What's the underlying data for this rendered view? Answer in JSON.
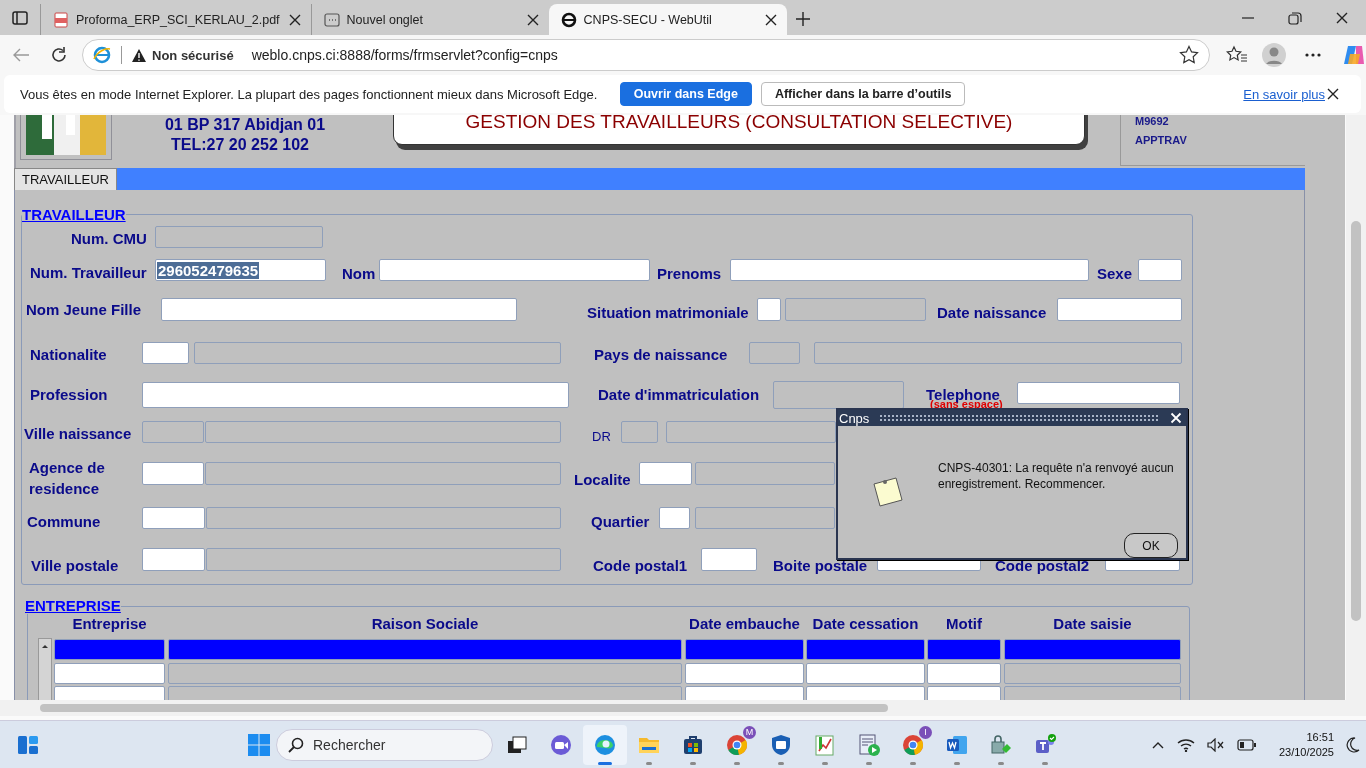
{
  "browser": {
    "tabs": [
      {
        "kind": "pdf",
        "title": "Proforma_ERP_SCI_KERLAU_2.pdf",
        "selected": false
      },
      {
        "kind": "newtab",
        "title": "Nouvel onglet",
        "selected": false
      },
      {
        "kind": "ie",
        "title": "CNPS-SECU - WebUtil",
        "selected": true
      }
    ],
    "address_bar": {
      "security": "Non sécurisé",
      "url": "weblo.cnps.ci:8888/forms/frmservlet?config=cnps"
    },
    "ie_mode_bar": {
      "message": "Vous êtes en mode Internet Explorer. La plupart des pages fonctionnent mieux dans Microsoft Edge.",
      "buttons": [
        {
          "label": "Ouvrir dans Edge",
          "primary": true
        },
        {
          "label": "Afficher dans la barre d’outils",
          "primary": false
        }
      ],
      "link": "En savoir plus"
    }
  },
  "header": {
    "address": "01 BP 317 Abidjan 01",
    "phone": "TEL:27 20 252 102",
    "title": "GESTION DES TRAVAILLEURS (CONSULTATION SELECTIVE)",
    "codes": [
      "M9692",
      "APPTRAV"
    ]
  },
  "form_tabs": [
    {
      "label": "TRAVAILLEUR",
      "selected": true
    }
  ],
  "travailleur": {
    "title": "TRAVAILLEUR",
    "fields": [
      {
        "label": "Num. CMU",
        "boxes": [
          {
            "editable": false
          }
        ]
      },
      {
        "label": "Num. Travailleur",
        "boxes": [
          {
            "editable": true,
            "value": "296052479635",
            "highlighted": true
          }
        ]
      },
      {
        "label": "Nom",
        "boxes": [
          {
            "editable": true
          }
        ]
      },
      {
        "label": "Prenoms",
        "boxes": [
          {
            "editable": true
          }
        ]
      },
      {
        "label": "Sexe",
        "boxes": [
          {
            "editable": true
          }
        ]
      },
      {
        "label": "Nom Jeune Fille",
        "boxes": [
          {
            "editable": true
          }
        ]
      },
      {
        "label": "Situation matrimoniale",
        "boxes": [
          {
            "editable": true
          },
          {
            "editable": false
          }
        ]
      },
      {
        "label": "Date naissance",
        "boxes": [
          {
            "editable": true
          }
        ]
      },
      {
        "label": "Nationalite",
        "boxes": [
          {
            "editable": true
          },
          {
            "editable": false
          }
        ]
      },
      {
        "label": "Pays de naissance",
        "boxes": [
          {
            "editable": false
          },
          {
            "editable": false
          }
        ]
      },
      {
        "label": "Profession",
        "boxes": [
          {
            "editable": true
          }
        ]
      },
      {
        "label": "Date d'immatriculation",
        "boxes": [
          {
            "editable": false
          }
        ]
      },
      {
        "label": "Telephone",
        "note": "(sans espace)",
        "boxes": [
          {
            "editable": true
          }
        ]
      },
      {
        "label": "Ville naissance",
        "boxes": [
          {
            "editable": false
          },
          {
            "editable": false
          }
        ]
      },
      {
        "label": "DR",
        "boxes": [
          {
            "editable": false
          },
          {
            "editable": false
          }
        ]
      },
      {
        "label": "Agence de residence",
        "boxes": [
          {
            "editable": true
          },
          {
            "editable": false
          }
        ]
      },
      {
        "label": "Localite",
        "boxes": [
          {
            "editable": true
          },
          {
            "editable": false
          }
        ]
      },
      {
        "label": "Commune",
        "boxes": [
          {
            "editable": true
          },
          {
            "editable": false
          }
        ]
      },
      {
        "label": "Quartier",
        "boxes": [
          {
            "editable": true
          },
          {
            "editable": false
          }
        ]
      },
      {
        "label": "Ville postale",
        "boxes": [
          {
            "editable": true
          },
          {
            "editable": false
          }
        ]
      },
      {
        "label": "Code postal1",
        "boxes": [
          {
            "editable": true
          }
        ]
      },
      {
        "label": "Boite postale",
        "boxes": [
          {
            "editable": true
          }
        ]
      },
      {
        "label": "Code postal2",
        "boxes": [
          {
            "editable": true
          }
        ]
      }
    ]
  },
  "entreprise": {
    "title": "ENTREPRISE",
    "columns": [
      {
        "label": "Entreprise",
        "editable": true
      },
      {
        "label": "Raison Sociale",
        "editable": false
      },
      {
        "label": "Date embauche",
        "editable": true
      },
      {
        "label": "Date cessation",
        "editable": true
      },
      {
        "label": "Motif",
        "editable": true
      },
      {
        "label": "Date saisie",
        "editable": false
      }
    ],
    "rows": [
      {
        "selected": true
      },
      {
        "selected": false
      },
      {
        "selected": false
      }
    ]
  },
  "dialog": {
    "title": "Cnps",
    "message": "CNPS-40301: La requête n'a renvoyé aucun enregistrement. Recommencer.",
    "button": "OK"
  },
  "taskbar": {
    "search": {
      "placeholder": "Rechercher"
    },
    "apps": [
      {
        "kind": "taskview",
        "running": false,
        "selected": false
      },
      {
        "kind": "meet",
        "running": false,
        "selected": false
      },
      {
        "kind": "edge",
        "running": true,
        "selected": true
      },
      {
        "kind": "files",
        "running": true,
        "selected": false
      },
      {
        "kind": "store",
        "running": true,
        "selected": false
      },
      {
        "kind": "chrome",
        "badge": "M",
        "running": true,
        "selected": false
      },
      {
        "kind": "shield",
        "running": true,
        "selected": false
      },
      {
        "kind": "sheet",
        "running": true,
        "selected": false
      },
      {
        "kind": "media",
        "running": true,
        "selected": false
      },
      {
        "kind": "chrome",
        "badge": "I",
        "running": true,
        "selected": false
      },
      {
        "kind": "word",
        "running": true,
        "selected": false
      },
      {
        "kind": "lock",
        "running": true,
        "selected": false
      },
      {
        "kind": "teams",
        "running": true,
        "selected": false
      }
    ],
    "time": "16:51",
    "date": "23/10/2025"
  }
}
